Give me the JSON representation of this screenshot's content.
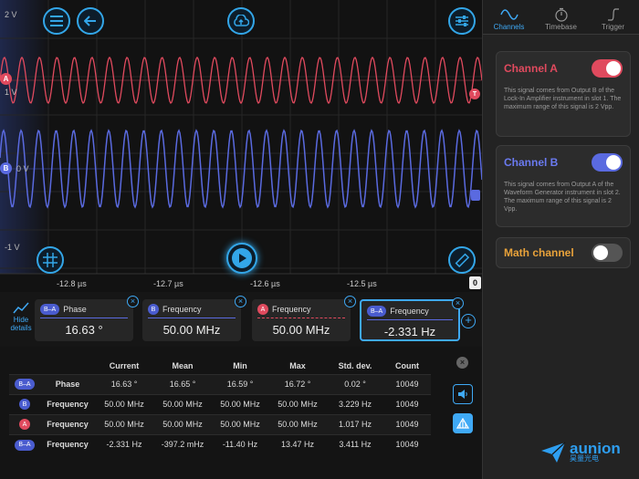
{
  "scope": {
    "voltage_labels": {
      "top": "2 V",
      "ch_a": "1 V",
      "ch_b": "0 V",
      "bottom": "-1 V"
    },
    "channel_markers": {
      "a": "A",
      "b": "B"
    },
    "time_ticks": [
      "-12.8 µs",
      "-12.7 µs",
      "-12.6 µs",
      "-12.5 µs"
    ],
    "zero_badge": "0",
    "colors": {
      "channel_a": "#e04a5e",
      "channel_b": "#5a6ae0",
      "accent": "#33a6e8"
    },
    "icons": {
      "menu": "menu-icon",
      "back": "back-arrow-icon",
      "cloud": "cloud-upload-icon",
      "settings": "sliders-icon",
      "grid": "grid-icon",
      "play": "play-icon",
      "ruler": "ruler-icon"
    }
  },
  "panel": {
    "tabs": [
      {
        "label": "Channels",
        "icon": "sine-wave-icon",
        "active": true
      },
      {
        "label": "Timebase",
        "icon": "stopwatch-icon",
        "active": false
      },
      {
        "label": "Trigger",
        "icon": "trigger-edge-icon",
        "active": false
      }
    ],
    "channel_a": {
      "title": "Channel A",
      "enabled": true,
      "description": "This signal comes from Output B of the Lock-In Amplifier instrument in slot 1. The maximum range of this signal is 2 Vpp."
    },
    "channel_b": {
      "title": "Channel B",
      "enabled": true,
      "description": "This signal comes from Output A of the Waveform Generator instrument in slot 2. The maximum range of this signal is 2 Vpp."
    },
    "math": {
      "title": "Math channel",
      "enabled": false
    }
  },
  "measurements": {
    "hide_details": "Hide details",
    "cards": [
      {
        "chip": "B–A",
        "name": "Phase",
        "value": "16.63 °"
      },
      {
        "chip": "B",
        "name": "Frequency",
        "value": "50.00 MHz"
      },
      {
        "chip": "A",
        "name": "Frequency",
        "value": "50.00 MHz"
      },
      {
        "chip": "B–A",
        "name": "Frequency",
        "value": "-2.331 Hz"
      }
    ]
  },
  "stats": {
    "headers": [
      "",
      "",
      "Current",
      "Mean",
      "Min",
      "Max",
      "Std. dev.",
      "Count"
    ],
    "rows": [
      {
        "chip": "B–A",
        "label": "Phase",
        "current": "16.63 °",
        "mean": "16.65 °",
        "min": "16.59 °",
        "max": "16.72 °",
        "std": "0.02 °",
        "count": "10049"
      },
      {
        "chip": "B",
        "label": "Frequency",
        "current": "50.00 MHz",
        "mean": "50.00 MHz",
        "min": "50.00 MHz",
        "max": "50.00 MHz",
        "std": "3.229 Hz",
        "count": "10049"
      },
      {
        "chip": "A",
        "label": "Frequency",
        "current": "50.00 MHz",
        "mean": "50.00 MHz",
        "min": "50.00 MHz",
        "max": "50.00 MHz",
        "std": "1.017 Hz",
        "count": "10049"
      },
      {
        "chip": "B–A",
        "label": "Frequency",
        "current": "-2.331 Hz",
        "mean": "-397.2 mHz",
        "min": "-11.40 Hz",
        "max": "13.47 Hz",
        "std": "3.411 Hz",
        "count": "10049"
      }
    ]
  },
  "watermark": {
    "brand": "aunion",
    "sub": "昊量光电"
  }
}
